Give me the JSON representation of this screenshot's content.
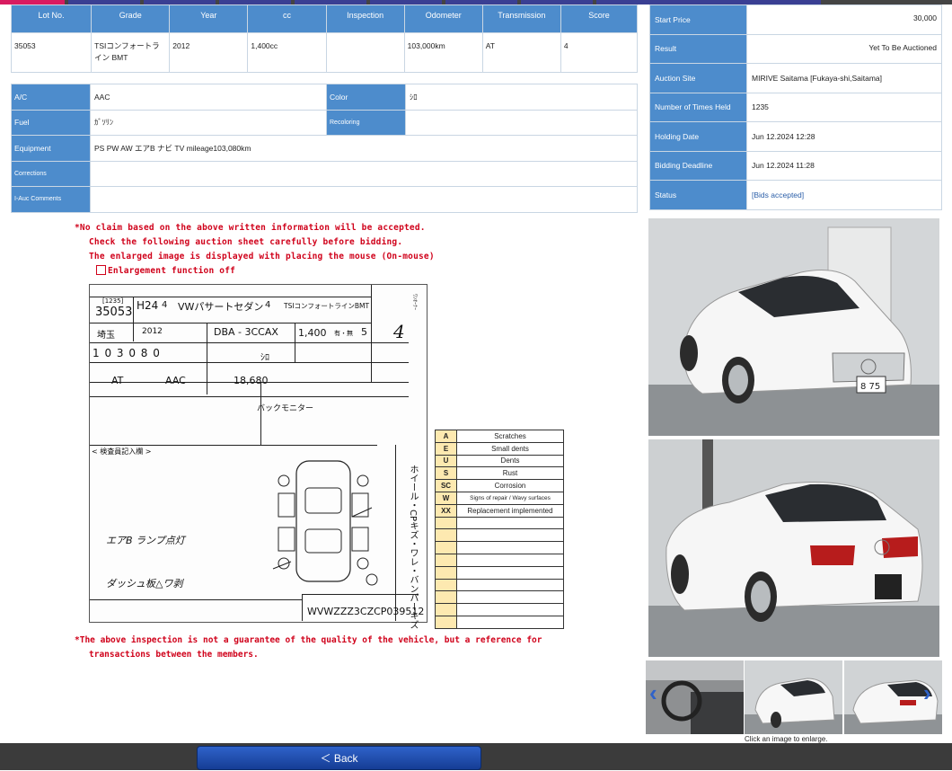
{
  "lot_table": {
    "headers": [
      "Lot No.",
      "Grade",
      "Year",
      "cc",
      "Inspection",
      "Odometer",
      "Transmission",
      "Score"
    ],
    "row": [
      "35053",
      "TSIコンフォートライン BMT",
      "2012",
      "1,400cc",
      "",
      "103,000km",
      "AT",
      "4"
    ]
  },
  "spec": {
    "ac_label": "A/C",
    "ac_value": "AAC",
    "color_label": "Color",
    "color_value": "ｼﾛ",
    "fuel_label": "Fuel",
    "fuel_value": "ｶﾞｿﾘﾝ",
    "recoloring_label": "Recoloring",
    "recoloring_value": "",
    "equipment_label": "Equipment",
    "equipment_value": "PS PW AW エアB ナビ TV mileage103,080km",
    "corrections_label": "Corrections",
    "corrections_value": "",
    "comments_label": "I-Auc Comments",
    "comments_value": ""
  },
  "side": {
    "start_price_label": "Start Price",
    "start_price": "30,000",
    "result_label": "Result",
    "result": "Yet To Be Auctioned",
    "site_label": "Auction Site",
    "site": "MIRIVE Saitama [Fukaya-shi,Saitama]",
    "times_label": "Number of Times Held",
    "times": "1235",
    "holding_label": "Holding Date",
    "holding": "Jun 12.2024 12:28",
    "deadline_label": "Bidding Deadline",
    "deadline": "Jun 12.2024 11:28",
    "status_label": "Status",
    "status": "[Bids accepted]"
  },
  "notes": {
    "line1": "*No claim based on the above written information will be accepted.",
    "line2": "Check the following auction sheet carefully before bidding.",
    "line3": "The enlarged image is displayed with placing the mouse (On-mouse)",
    "enlarge_label": "Enlargement function off",
    "footer1": "*The above inspection is not a guarantee of the quality of the vehicle, but a reference for",
    "footer2": "transactions between the members."
  },
  "sheet": {
    "times": "[1235]",
    "lot": "35053",
    "era_year": "H24",
    "year_digit": "4",
    "model": "VWパサートセダン",
    "doors": "4",
    "grade": "TSIコンフォートラインBMT",
    "pref": "埼玉",
    "year": "2012",
    "chassis": "DBA - 3CCAX",
    "cc": "1,400",
    "shift_mark": "有・無",
    "seats": "5",
    "score": "4",
    "odometer": "1 0 3 0 8 0",
    "color": "ｼﾛ",
    "shift": "AT",
    "ac": "AAC",
    "recycle": "18,680",
    "sales_point": "バックモニター",
    "notes_header": "< 検査員記入欄 >",
    "note1": "エアB ランプ点灯",
    "note2": "ダッシュ板△ワ剥",
    "vin": "WVWZZZ3CZCP039512"
  },
  "legend": [
    {
      "key": "A",
      "desc": "Scratches"
    },
    {
      "key": "E",
      "desc": "Small dents"
    },
    {
      "key": "U",
      "desc": "Dents"
    },
    {
      "key": "S",
      "desc": "Rust"
    },
    {
      "key": "SC",
      "desc": "Corrosion"
    },
    {
      "key": "W",
      "desc": "Signs of repair / Wavy surfaces"
    },
    {
      "key": "XX",
      "desc": "Replacement implemented"
    }
  ],
  "photos": {
    "caption": "Click an image to enlarge.",
    "plate": "8 75"
  },
  "back_label": "＜ Back"
}
